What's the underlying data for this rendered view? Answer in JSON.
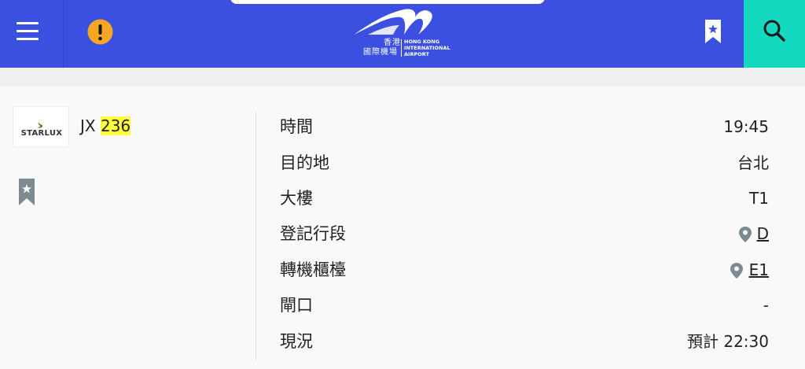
{
  "header": {
    "logo": {
      "zh_top": "香港",
      "zh_bottom": "國際機場",
      "en_line1": "HONG KONG",
      "en_line2": "INTERNATIONAL",
      "en_line3": "AIRPORT"
    },
    "colors": {
      "bar": "#3b4fe0",
      "search": "#14d9c1",
      "alert": "#f5a623"
    },
    "icons": [
      "menu-icon",
      "alert-icon",
      "bookmark-icon",
      "search-icon"
    ]
  },
  "flight": {
    "airline_logo_text": "STARLUX",
    "airline_code": "JX",
    "number": "236",
    "highlight_color": "#ffff3c"
  },
  "details": [
    {
      "label": "時間",
      "value": "19:45"
    },
    {
      "label": "目的地",
      "value": "台北"
    },
    {
      "label": "大樓",
      "value": "T1"
    },
    {
      "label": "登記行段",
      "value": "D"
    },
    {
      "label": "轉機櫃檯",
      "value": "E1"
    },
    {
      "label": "閘口",
      "value": "-"
    },
    {
      "label": "現況",
      "value": "預計 22:30"
    }
  ]
}
